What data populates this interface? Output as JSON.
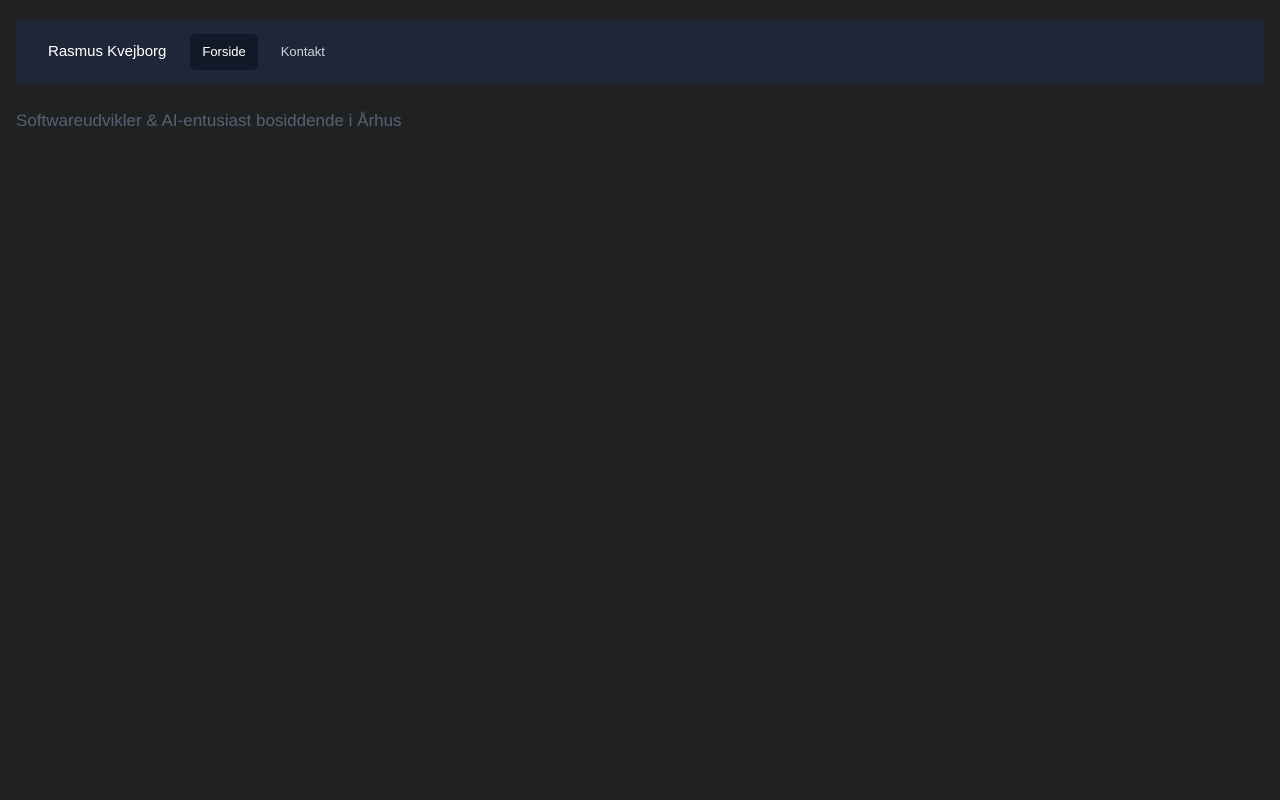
{
  "navbar": {
    "brand": "Rasmus Kvejborg",
    "links": [
      {
        "label": "Forside",
        "active": true
      },
      {
        "label": "Kontakt",
        "active": false
      }
    ]
  },
  "main": {
    "tagline": "Softwareudvikler & AI-entusiast bosiddende i Århus"
  },
  "colors": {
    "page_background": "#202122",
    "navbar_background": "#1e2738",
    "active_link_background": "#111827",
    "tagline_text": "#566173"
  }
}
